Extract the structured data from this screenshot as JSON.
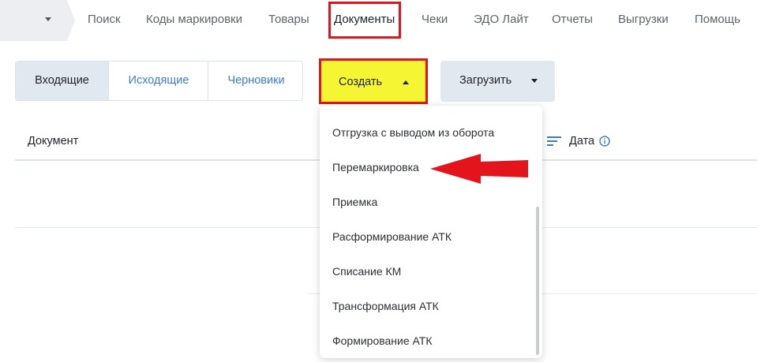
{
  "nav": {
    "items": [
      "Поиск",
      "Коды маркировки",
      "Товары",
      "Документы",
      "Чеки",
      "ЭДО Лайт",
      "Отчеты",
      "Выгрузки",
      "Помощь"
    ],
    "active": "Документы"
  },
  "tabs": {
    "incoming": "Входящие",
    "outgoing": "Исходящие",
    "drafts": "Черновики"
  },
  "actions": {
    "create_label": "Создать",
    "upload_label": "Загрузить"
  },
  "table": {
    "col_document": "Документ",
    "col_date": "Дата"
  },
  "dropdown": {
    "items": [
      "Отгрузка с выводом из оборота",
      "Перемаркировка",
      "Приемка",
      "Расформирование АТК",
      "Списание КМ",
      "Трансформация АТК",
      "Формирование АТК"
    ]
  },
  "colors": {
    "highlight_border": "#e3141b",
    "create_button_bg": "#f5f534",
    "link_blue": "#3b7bd5",
    "arrow": "#e3141b"
  }
}
